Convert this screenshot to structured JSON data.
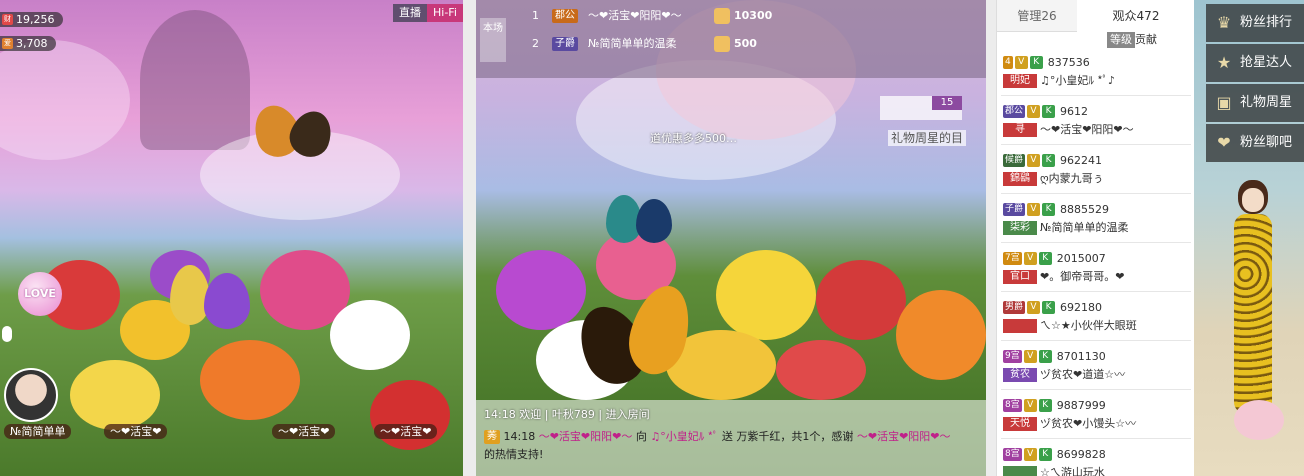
{
  "video": {
    "wealth_icon": "财",
    "wealth": "19,256",
    "fans_icon": "爱",
    "fans": "3,708",
    "live_label": "直播",
    "quality_label": "Hi-Fi",
    "love_label": "LOVE",
    "stage": [
      "№简简单单",
      "～❤活宝❤",
      "～❤活宝❤",
      "～❤活宝❤"
    ]
  },
  "rank": {
    "room_tag": "本场",
    "row1": {
      "rank": "1",
      "badge": "郡公",
      "name": "～❤活宝❤阳阳❤～",
      "value": "10300"
    },
    "row2": {
      "rank": "2",
      "badge": "子爵",
      "name": "№简简单单的温柔",
      "value": "500"
    }
  },
  "notice": {
    "car_count": "15",
    "text": "礼物周星的目",
    "marquee": "道优惠多多500…"
  },
  "chat": {
    "line1": "14:18 欢迎 | 叶秋789 | 进入房间",
    "time": "14:18",
    "tag": "莠",
    "sender": "～❤活宝❤阳阳❤～",
    "action": " 向 ",
    "target": "♫°小皇妃ﾙ *ﾟ",
    "mid": " 送 ",
    "gift": " 万紫千红，共1个，感谢 ",
    "thanks_name": "～❤活宝❤阳阳❤～",
    "tail": " 的热情支持!"
  },
  "audience": {
    "tab_admin": "管理26",
    "tab_viewers": "观众472",
    "col_level": "等级",
    "col_contrib": "贡献",
    "rows": [
      {
        "lvl": "4",
        "id": "837536",
        "title": "明妃",
        "nick": "♫°小皇妃ﾙ *ﾟ♪",
        "tcolor": "#c83a3a",
        "lcolor": "#d08a10"
      },
      {
        "lvl": "郡公",
        "id": "9612",
        "title": "寻",
        "nick": "～❤活宝❤阳阳❤～",
        "tcolor": "#c83a3a",
        "lcolor": "#5a4aa0"
      },
      {
        "lvl": "候爵",
        "id": "962241",
        "title": "錦鷂",
        "nick": "ღ内蒙九哥ぅ",
        "tcolor": "#c83a3a",
        "lcolor": "#3a6a3a"
      },
      {
        "lvl": "子爵",
        "id": "8885529",
        "title": "柒彩",
        "nick": "№简简单单的温柔",
        "tcolor": "#4a8a4a",
        "lcolor": "#5a4aa0"
      },
      {
        "lvl": "7宫",
        "id": "2015007",
        "title": "官口",
        "nick": "❤。御帝哥哥。❤",
        "tcolor": "#c83a3a",
        "lcolor": "#d08a10"
      },
      {
        "lvl": "男爵",
        "id": "692180",
        "title": "",
        "nick": "ㄟ☆★小伙伴大眼斑",
        "tcolor": "#c83a3a",
        "lcolor": "#b03a3a"
      },
      {
        "lvl": "9宫",
        "id": "8701130",
        "title": "贫农",
        "nick": "ヅ贫农❤道道☆〰",
        "tcolor": "#7a4ab0",
        "lcolor": "#a040a0"
      },
      {
        "lvl": "8宫",
        "id": "9887999",
        "title": "天悦",
        "nick": "ヅ贫农❤小馒头☆〰",
        "tcolor": "#c83a3a",
        "lcolor": "#a040a0"
      },
      {
        "lvl": "8宫",
        "id": "8699828",
        "title": "",
        "nick": "☆ㄟ游山玩水",
        "tcolor": "#4a8a4a",
        "lcolor": "#a040a0"
      }
    ]
  },
  "side": {
    "btn1": "粉丝排行",
    "btn2": "抢星达人",
    "btn3": "礼物周星",
    "btn4": "粉丝聊吧"
  },
  "colors": {
    "accent": "#8c4aa0",
    "badge_green": "#3aa04a",
    "badge_gold": "#d0a020"
  }
}
